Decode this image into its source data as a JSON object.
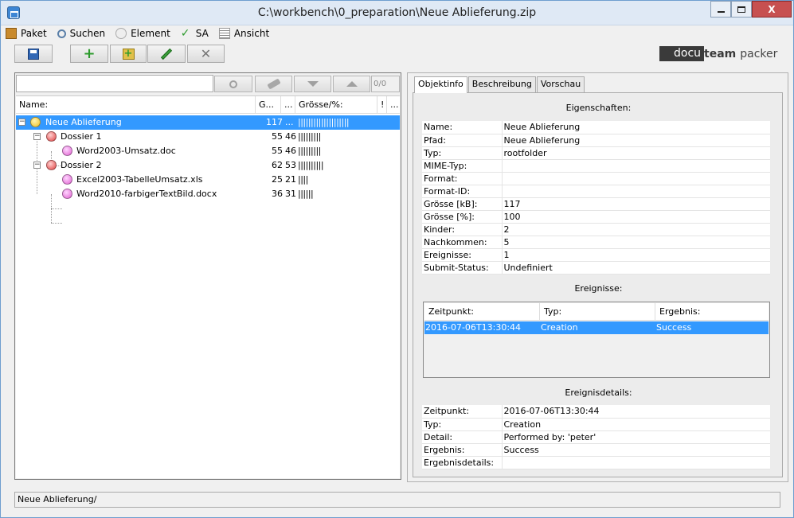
{
  "window": {
    "title": "C:\\workbench\\0_preparation\\Neue Ablieferung.zip",
    "close_label": "X"
  },
  "menu": [
    {
      "label": "Paket",
      "icon": "package-icon"
    },
    {
      "label": "Suchen",
      "icon": "search-icon"
    },
    {
      "label": "Element",
      "icon": "element-icon"
    },
    {
      "label": "SA",
      "icon": "checkmark-icon"
    },
    {
      "label": "Ansicht",
      "icon": "list-icon"
    }
  ],
  "logo": {
    "part1": "docu",
    "part2": "team",
    "part3": "packer"
  },
  "search": {
    "value": "",
    "count": "0/0"
  },
  "tree": {
    "columns": [
      "Name:",
      "G...",
      "...",
      "Grösse/%:",
      "!",
      "..."
    ],
    "rows": [
      {
        "name": "Neue Ablieferung",
        "g": "117",
        "pct": "...",
        "bar": "||||||||||||||||||||",
        "level": 0,
        "color": "yellow",
        "selected": true
      },
      {
        "name": "Dossier 1",
        "g": "55",
        "pct": "46",
        "bar": "|||||||||",
        "level": 1,
        "color": "red",
        "selected": false
      },
      {
        "name": "Word2003-Umsatz.doc",
        "g": "55",
        "pct": "46",
        "bar": "|||||||||",
        "level": 2,
        "color": "pink",
        "selected": false
      },
      {
        "name": "Dossier 2",
        "g": "62",
        "pct": "53",
        "bar": "||||||||||",
        "level": 1,
        "color": "red",
        "selected": false
      },
      {
        "name": "Excel2003-TabelleUmsatz.xls",
        "g": "25",
        "pct": "21",
        "bar": "||||",
        "level": 2,
        "color": "pink",
        "selected": false
      },
      {
        "name": "Word2010-farbigerTextBild.docx",
        "g": "36",
        "pct": "31",
        "bar": "||||||",
        "level": 2,
        "color": "pink",
        "selected": false
      }
    ]
  },
  "tabs": [
    "Objektinfo",
    "Beschreibung",
    "Vorschau"
  ],
  "eigenschaften": {
    "title": "Eigenschaften:",
    "rows": [
      {
        "k": "Name:",
        "v": "Neue Ablieferung"
      },
      {
        "k": "Pfad:",
        "v": "Neue Ablieferung"
      },
      {
        "k": "Typ:",
        "v": "rootfolder"
      },
      {
        "k": "MIME-Typ:",
        "v": ""
      },
      {
        "k": "Format:",
        "v": ""
      },
      {
        "k": "Format-ID:",
        "v": ""
      },
      {
        "k": "Grösse [kB]:",
        "v": "117"
      },
      {
        "k": "Grösse [%]:",
        "v": "100"
      },
      {
        "k": "Kinder:",
        "v": "2"
      },
      {
        "k": "Nachkommen:",
        "v": "5"
      },
      {
        "k": "Ereignisse:",
        "v": "1"
      },
      {
        "k": "Submit-Status:",
        "v": "Undefiniert"
      }
    ]
  },
  "ereignisse": {
    "title": "Ereignisse:",
    "columns": [
      "Zeitpunkt:",
      "Typ:",
      "Ergebnis:"
    ],
    "rows": [
      {
        "zeitpunkt": "2016-07-06T13:30:44",
        "typ": "Creation",
        "ergebnis": "Success"
      }
    ]
  },
  "details": {
    "title": "Ereignisdetails:",
    "rows": [
      {
        "k": "Zeitpunkt:",
        "v": "2016-07-06T13:30:44"
      },
      {
        "k": "Typ:",
        "v": "Creation"
      },
      {
        "k": "Detail:",
        "v": "Performed by: 'peter'"
      },
      {
        "k": "Ergebnis:",
        "v": "Success"
      },
      {
        "k": "Ergebnisdetails:",
        "v": ""
      }
    ]
  },
  "status": {
    "text": "Neue Ablieferung/"
  },
  "colors": {
    "selection": "#3399ff",
    "titlebar": "#dfe9f5",
    "close": "#c75050"
  }
}
